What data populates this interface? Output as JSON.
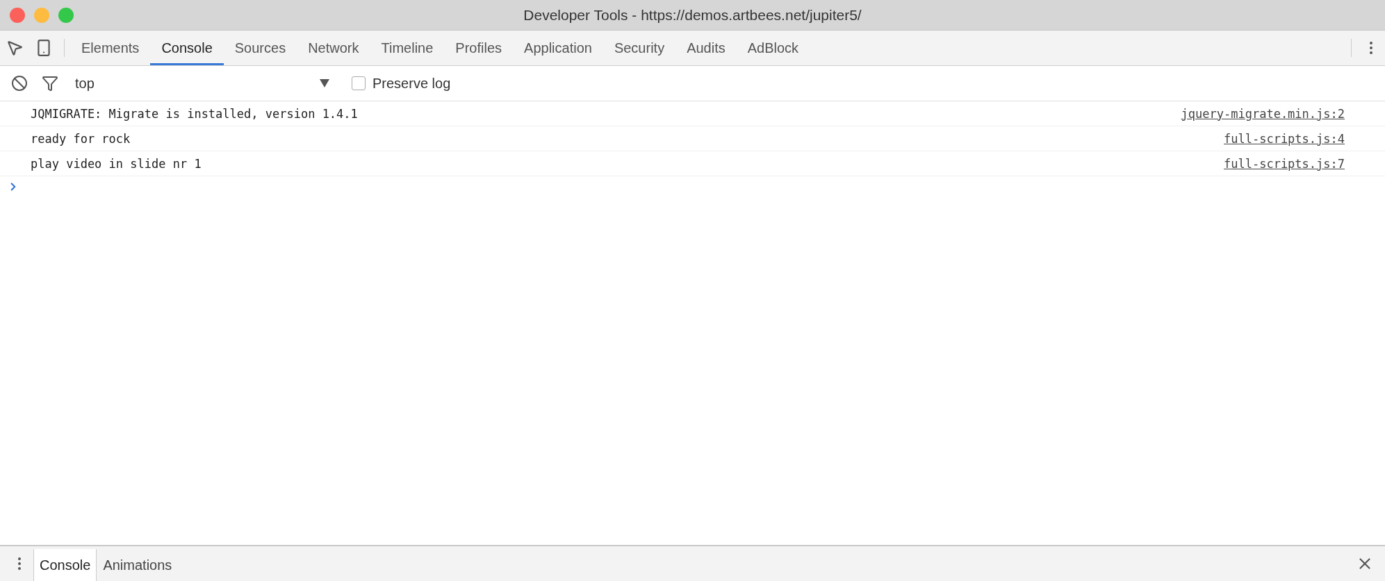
{
  "window": {
    "title": "Developer Tools - https://demos.artbees.net/jupiter5/"
  },
  "tabs": [
    {
      "label": "Elements",
      "selected": false
    },
    {
      "label": "Console",
      "selected": true
    },
    {
      "label": "Sources",
      "selected": false
    },
    {
      "label": "Network",
      "selected": false
    },
    {
      "label": "Timeline",
      "selected": false
    },
    {
      "label": "Profiles",
      "selected": false
    },
    {
      "label": "Application",
      "selected": false
    },
    {
      "label": "Security",
      "selected": false
    },
    {
      "label": "Audits",
      "selected": false
    },
    {
      "label": "AdBlock",
      "selected": false
    }
  ],
  "filter_bar": {
    "context": "top",
    "preserve_log": {
      "label": "Preserve log",
      "checked": false
    }
  },
  "messages": [
    {
      "text": "JQMIGRATE: Migrate is installed, version 1.4.1",
      "source": "jquery-migrate.min.js:2"
    },
    {
      "text": "ready for rock",
      "source": "full-scripts.js:4"
    },
    {
      "text": "play video in slide nr 1",
      "source": "full-scripts.js:7"
    }
  ],
  "drawer": {
    "tabs": [
      {
        "label": "Console",
        "selected": true
      },
      {
        "label": "Animations",
        "selected": false
      }
    ]
  }
}
